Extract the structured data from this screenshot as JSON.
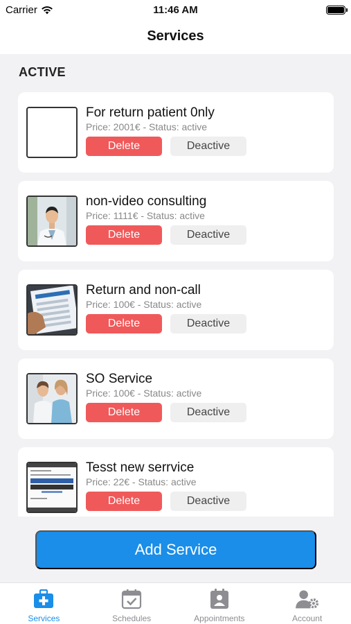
{
  "status_bar": {
    "carrier": "Carrier",
    "time": "11:46 AM"
  },
  "nav": {
    "title": "Services"
  },
  "section": {
    "header": "ACTIVE"
  },
  "services": [
    {
      "title": "For return patient 0nly",
      "meta": "Price: 2001€ - Status: active",
      "delete_label": "Delete",
      "deactive_label": "Deactive",
      "image": "blank"
    },
    {
      "title": "non-video consulting",
      "meta": "Price: 1111€ - Status: active",
      "delete_label": "Delete",
      "deactive_label": "Deactive",
      "image": "doctor-photo"
    },
    {
      "title": "Return and non-call",
      "meta": "Price: 100€ - Status: active",
      "delete_label": "Delete",
      "deactive_label": "Deactive",
      "image": "tablet-photo"
    },
    {
      "title": "SO Service",
      "meta": "Price: 100€ - Status: active",
      "delete_label": "Delete",
      "deactive_label": "Deactive",
      "image": "consultation-photo"
    },
    {
      "title": "Tesst new serrvice",
      "meta": "Price: 22€ - Status: active",
      "delete_label": "Delete",
      "deactive_label": "Deactive",
      "image": "screenshot-image"
    }
  ],
  "add_button": {
    "label": "Add Service"
  },
  "tabs": [
    {
      "label": "Services",
      "icon": "medical-kit-icon",
      "active": true
    },
    {
      "label": "Schedules",
      "icon": "calendar-check-icon",
      "active": false
    },
    {
      "label": "Appointments",
      "icon": "appointment-badge-icon",
      "active": false
    },
    {
      "label": "Account",
      "icon": "user-settings-icon",
      "active": false
    }
  ],
  "colors": {
    "accent": "#1a8ee8",
    "delete": "#f0595a",
    "deactive_bg": "#efefef",
    "tab_inactive": "#8d8d92"
  }
}
